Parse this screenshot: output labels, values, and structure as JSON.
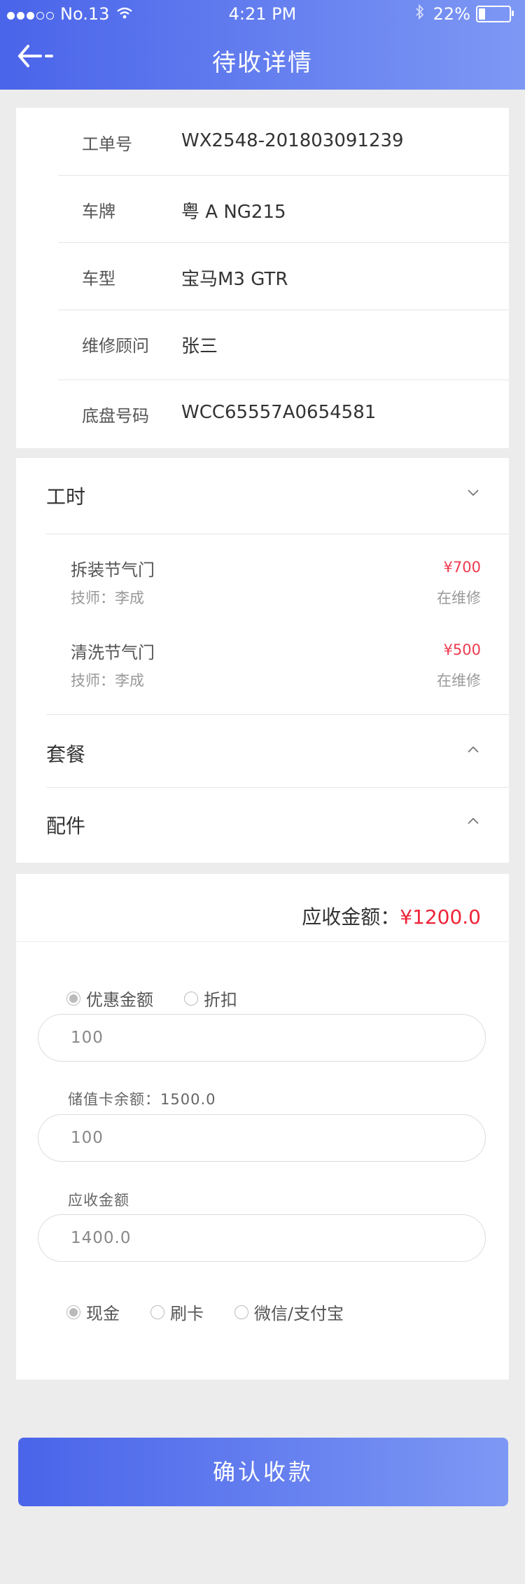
{
  "status_bar": {
    "signal": "●●●○○",
    "carrier": "No.13",
    "time": "4:21 PM",
    "battery": "22%"
  },
  "header": {
    "title": "待收详情",
    "back_icon": "back-arrow-icon"
  },
  "info": {
    "rows": [
      {
        "label": "工单号",
        "value": "WX2548-201803091239"
      },
      {
        "label": "车牌",
        "value": "粤 A NG215"
      },
      {
        "label": "车型",
        "value": "宝马M3 GTR"
      },
      {
        "label": "维修顾问",
        "value": "张三"
      },
      {
        "label": "底盘号码",
        "value": "WCC65557A0654581"
      }
    ]
  },
  "sections": {
    "labor": {
      "title": "工时",
      "items": [
        {
          "name": "拆装节气门",
          "tech": "技师：李成",
          "price": "¥700",
          "status": "在维修"
        },
        {
          "name": "清洗节气门",
          "tech": "技师：李成",
          "price": "¥500",
          "status": "在维修"
        }
      ]
    },
    "package": {
      "title": "套餐"
    },
    "parts": {
      "title": "配件"
    }
  },
  "payment": {
    "due_label": "应收金额：",
    "due_amount": "¥1200.0",
    "discount_options": [
      "优惠金额",
      "折扣"
    ],
    "discount_selected": 0,
    "discount_value": "100",
    "card_label": "储值卡余额：1500.0",
    "card_value": "100",
    "receivable_label": "应收金额",
    "receivable_value": "1400.0",
    "method_options": [
      "现金",
      "刷卡",
      "微信/支付宝"
    ],
    "method_selected": 0
  },
  "confirm_label": "确认收款",
  "colors": {
    "accent_start": "#4a64ea",
    "accent_end": "#7d98f4",
    "price_red": "#ef3a4f"
  }
}
